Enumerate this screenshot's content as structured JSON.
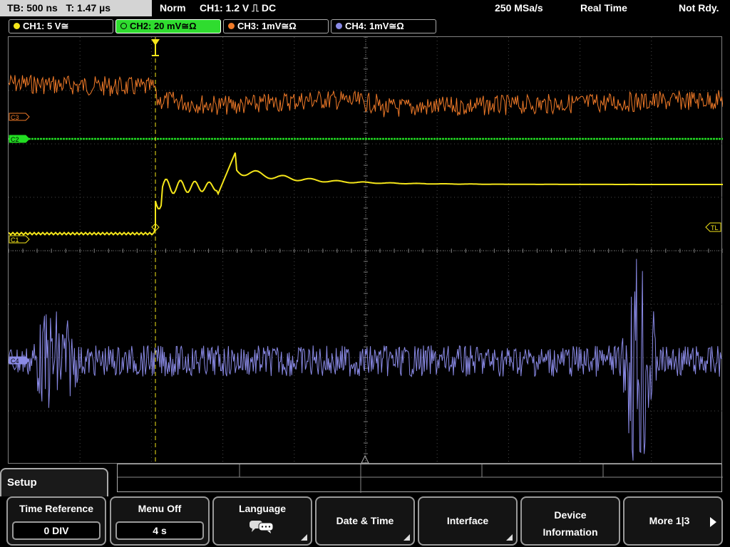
{
  "status_bar": {
    "timebase": "TB: 500 ns",
    "trigger_time": "T: 1.47 µs",
    "acq_mode": "Norm",
    "trigger_info": "CH1: 1.2 V ⎍ DC",
    "sample_rate": "250 MSa/s",
    "realtime": "Real Time",
    "state": "Not Rdy."
  },
  "channels": [
    {
      "id": "CH1",
      "label": "CH1: 5 V≅",
      "color": "#f5e61a",
      "active": false
    },
    {
      "id": "CH2",
      "label": "CH2: 20 mV≅Ω",
      "color": "#22dd22",
      "active": true
    },
    {
      "id": "CH3",
      "label": "CH3: 1mV≅Ω",
      "color": "#f07a28",
      "active": false
    },
    {
      "id": "CH4",
      "label": "CH4: 1mV≅Ω",
      "color": "#8a8ae6",
      "active": false
    }
  ],
  "markers": {
    "c3": "C3",
    "c2": "C2",
    "c1": "C1",
    "c4": "C4",
    "trigger_level": "TL"
  },
  "menu": {
    "title": "Setup",
    "softkeys": [
      {
        "label": "Time Reference",
        "value": "0 DIV"
      },
      {
        "label": "Menu Off",
        "value": "4 s"
      },
      {
        "label": "Language",
        "icon": "speech-bubble-icon"
      },
      {
        "label": "Date & Time"
      },
      {
        "label": "Interface"
      },
      {
        "label": "Device Information"
      },
      {
        "label": "More 1|3",
        "icon": "right-arrow-icon"
      }
    ]
  },
  "colors": {
    "ch1": "#f5e61a",
    "ch2": "#22dd22",
    "ch3": "#f07a28",
    "ch4": "#8a8ae6",
    "active_tab": "#2fdc2f",
    "grid": "#5a5a5a"
  }
}
